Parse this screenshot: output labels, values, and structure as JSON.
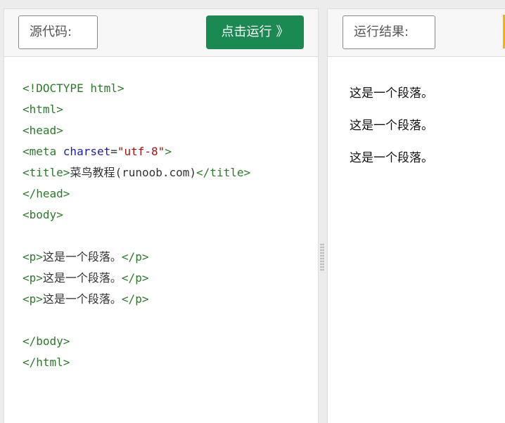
{
  "source_panel": {
    "label": "源代码:",
    "run_button": {
      "label": "点击运行",
      "chevron": "》"
    },
    "code_lines": [
      [
        {
          "cls": "tag",
          "t": "<!DOCTYPE html>"
        }
      ],
      [
        {
          "cls": "tag",
          "t": "<html>"
        }
      ],
      [
        {
          "cls": "tag",
          "t": "<head>"
        }
      ],
      [
        {
          "cls": "tag",
          "t": "<meta "
        },
        {
          "cls": "attr",
          "t": "charset"
        },
        {
          "cls": "txt",
          "t": "="
        },
        {
          "cls": "val",
          "t": "\"utf-8\""
        },
        {
          "cls": "tag",
          "t": ">"
        }
      ],
      [
        {
          "cls": "tag",
          "t": "<title>"
        },
        {
          "cls": "txt",
          "t": "菜鸟教程(runoob.com)"
        },
        {
          "cls": "tag",
          "t": "</title>"
        }
      ],
      [
        {
          "cls": "tag",
          "t": "</head>"
        }
      ],
      [
        {
          "cls": "tag",
          "t": "<body>"
        }
      ],
      [],
      [
        {
          "cls": "tag",
          "t": "<p>"
        },
        {
          "cls": "txt",
          "t": "这是一个段落。"
        },
        {
          "cls": "tag",
          "t": "</p>"
        }
      ],
      [
        {
          "cls": "tag",
          "t": "<p>"
        },
        {
          "cls": "txt",
          "t": "这是一个段落。"
        },
        {
          "cls": "tag",
          "t": "</p>"
        }
      ],
      [
        {
          "cls": "tag",
          "t": "<p>"
        },
        {
          "cls": "txt",
          "t": "这是一个段落。"
        },
        {
          "cls": "tag",
          "t": "</p>"
        }
      ],
      [],
      [
        {
          "cls": "tag",
          "t": "</body>"
        }
      ],
      [
        {
          "cls": "tag",
          "t": "</html>"
        }
      ]
    ]
  },
  "result_panel": {
    "label": "运行结果:",
    "paragraphs": [
      "这是一个段落。",
      "这是一个段落。",
      "这是一个段落。"
    ]
  },
  "colors": {
    "run_button": "#1a8a52",
    "tag": "#2b7a2b",
    "attr": "#1c1cb0",
    "value": "#a31515",
    "accent_edge": "#f2b600"
  }
}
